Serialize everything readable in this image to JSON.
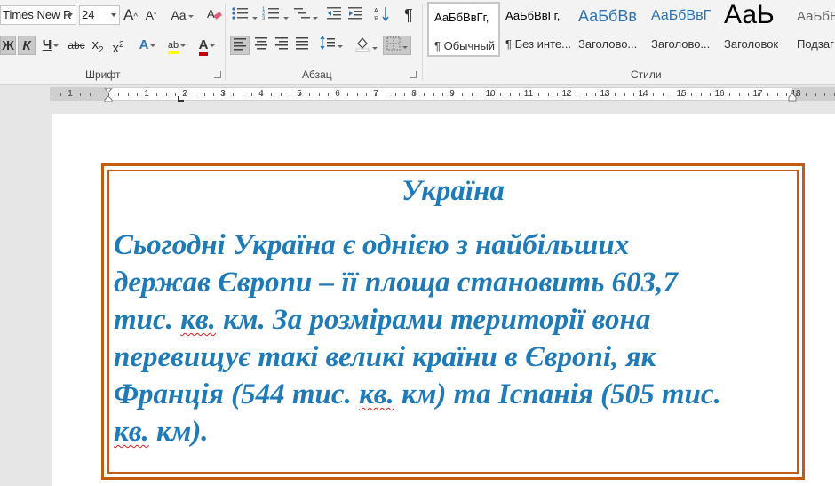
{
  "ribbon": {
    "font": {
      "name": "Times New R",
      "size": "24",
      "group_label": "Шрифт",
      "grow_glyph": "A",
      "shrink_glyph": "A",
      "change_case_label": "Aa",
      "bold_label": "Ж",
      "italic_label": "К",
      "underline_label": "Ч",
      "strike_label": "abc",
      "subscript_label": "x",
      "subscript_mark": "2",
      "superscript_label": "x",
      "superscript_mark": "2",
      "font_color_label": "A",
      "text_effect_label": "A",
      "highlight_label": "ab"
    },
    "paragraph": {
      "group_label": "Абзац",
      "show_marks_glyph": "¶"
    },
    "styles": {
      "group_label": "Стили",
      "items": [
        {
          "sample": "АаБбВвГг,",
          "name": "¶ Обычный"
        },
        {
          "sample": "АаБбВвГг,",
          "name": "¶ Без инте..."
        },
        {
          "sample": "АаБбВв",
          "name": "Заголово..."
        },
        {
          "sample": "АаБбВвГ",
          "name": "Заголово..."
        },
        {
          "sample": "АаЬ",
          "name": "Заголовок"
        },
        {
          "sample": "АаБбВ",
          "name": "Подзаг"
        }
      ]
    },
    "colors": {
      "accent_blue": "#2e74b5",
      "highlight_yellow": "#ffff00",
      "font_red": "#c00000"
    }
  },
  "ruler": {
    "numbers": [
      "1",
      "1",
      "2",
      "3",
      "4",
      "5",
      "6",
      "7",
      "8",
      "9",
      "10",
      "11",
      "12",
      "13",
      "14",
      "15",
      "16",
      "17",
      "18"
    ]
  },
  "document": {
    "title": "Україна",
    "lines": [
      {
        "parts": [
          {
            "text": "Сьогодні Україна є однією з найбільших",
            "sq": false
          }
        ]
      },
      {
        "parts": [
          {
            "text": "держав Європи – її площа становить 603,7",
            "sq": false
          }
        ]
      },
      {
        "parts": [
          {
            "text": "тис. ",
            "sq": false
          },
          {
            "text": "кв.",
            "sq": true
          },
          {
            "text": " км. За розмірами території вона",
            "sq": false
          }
        ]
      },
      {
        "parts": [
          {
            "text": "перевищує такі великі країни в Європі, як",
            "sq": false
          }
        ]
      },
      {
        "parts": [
          {
            "text": "Франція (544 тис. ",
            "sq": false
          },
          {
            "text": "кв.",
            "sq": true
          },
          {
            "text": " км) та Іспанія (505 тис.",
            "sq": false
          }
        ]
      },
      {
        "parts": [
          {
            "text": "кв.",
            "sq": true
          },
          {
            "text": " км).",
            "sq": false
          }
        ]
      }
    ],
    "text_color": "#1f7ab8",
    "border_color": "#c55a11"
  }
}
